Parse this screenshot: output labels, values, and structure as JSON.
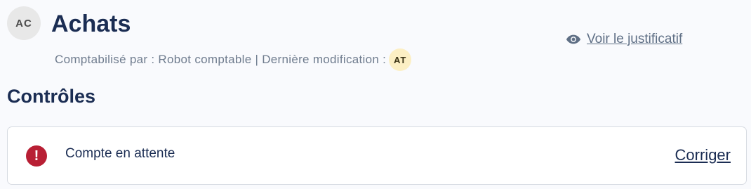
{
  "header": {
    "avatar_initials": "AC",
    "title": "Achats",
    "meta_text": "Comptabilisé par : Robot comptable | Dernière modification :",
    "modifier_initials": "AT",
    "voucher_link_label": "Voir le justificatif",
    "voucher_icon": "eye-icon"
  },
  "controls": {
    "section_title": "Contrôles",
    "items": [
      {
        "icon": "alert-icon",
        "icon_glyph": "!",
        "label": "Compte en attente",
        "action_label": "Corriger"
      }
    ]
  },
  "colors": {
    "background": "#f9fafd",
    "text_primary": "#1b2d53",
    "text_muted": "#6f7c8e",
    "alert": "#b81f34",
    "avatar_ac_bg": "#e8e8e8",
    "avatar_at_bg": "#fcefc4"
  }
}
